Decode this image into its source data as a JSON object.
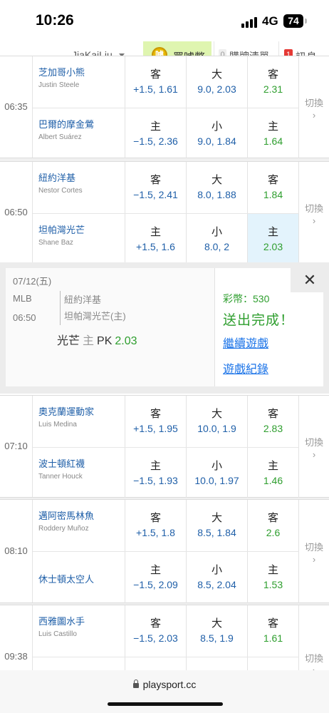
{
  "status_bar": {
    "time": "10:26",
    "network": "4G",
    "battery": "74"
  },
  "header": {
    "user": "JiaKaiLiu",
    "buy_label": "買噱幣",
    "buy_icon_text": "噱",
    "cart_count": "0",
    "cart_label": "購牌清單",
    "msg_count": "1",
    "msg_label": "訊息"
  },
  "switch_label": "切換",
  "switch_arrow": "›",
  "games": [
    {
      "time": "06:35",
      "away": {
        "team": "芝加哥小熊",
        "pitcher": "Justin Steele",
        "c1_top": "客",
        "c1_val": "+1.5, 1.61",
        "c2_top": "大",
        "c2_val": "9.0, 2.03",
        "c3_top": "客",
        "c3_val": "2.31"
      },
      "home": {
        "team": "巴爾的摩金鶯",
        "pitcher": "Albert Suárez",
        "c1_top": "主",
        "c1_val": "−1.5, 2.36",
        "c2_top": "小",
        "c2_val": "9.0, 1.84",
        "c3_top": "主",
        "c3_val": "1.64"
      }
    },
    {
      "time": "06:50",
      "away": {
        "team": "紐約洋基",
        "pitcher": "Nestor Cortes",
        "c1_top": "客",
        "c1_val": "−1.5, 2.41",
        "c2_top": "大",
        "c2_val": "8.0, 1.88",
        "c3_top": "客",
        "c3_val": "1.84"
      },
      "home": {
        "team": "坦帕灣光芒",
        "pitcher": "Shane Baz",
        "c1_top": "主",
        "c1_val": "+1.5, 1.6",
        "c2_top": "小",
        "c2_val": "8.0, 2",
        "c3_top": "主",
        "c3_val": "2.03"
      }
    },
    {
      "time": "07:10",
      "away": {
        "team": "奧克蘭運動家",
        "pitcher": "Luis Medina",
        "c1_top": "客",
        "c1_val": "+1.5, 1.95",
        "c2_top": "大",
        "c2_val": "10.0, 1.9",
        "c3_top": "客",
        "c3_val": "2.83"
      },
      "home": {
        "team": "波士頓紅襪",
        "pitcher": "Tanner Houck",
        "c1_top": "主",
        "c1_val": "−1.5, 1.93",
        "c2_top": "小",
        "c2_val": "10.0, 1.97",
        "c3_top": "主",
        "c3_val": "1.46"
      }
    },
    {
      "time": "08:10",
      "away": {
        "team": "邁阿密馬林魚",
        "pitcher": "Roddery Muñoz",
        "c1_top": "客",
        "c1_val": "+1.5, 1.8",
        "c2_top": "大",
        "c2_val": "8.5, 1.84",
        "c3_top": "客",
        "c3_val": "2.6"
      },
      "home": {
        "team": "休士頓太空人",
        "pitcher": "",
        "c1_top": "主",
        "c1_val": "−1.5, 2.09",
        "c2_top": "小",
        "c2_val": "8.5, 2.04",
        "c3_top": "主",
        "c3_val": "1.53"
      }
    },
    {
      "time": "09:38",
      "away": {
        "team": "西雅圖水手",
        "pitcher": "Luis Castillo",
        "c1_top": "客",
        "c1_val": "−1.5, 2.03",
        "c2_top": "大",
        "c2_val": "8.5, 1.9",
        "c3_top": "客",
        "c3_val": "1.61"
      }
    }
  ],
  "confirm_panel": {
    "date": "07/12(五)",
    "league": "MLB",
    "time": "06:50",
    "team1": "紐約洋基",
    "team2": "坦帕灣光芒(主)",
    "pick_team": "光芒",
    "pick_side": "主",
    "pick_type": "PK",
    "pick_odds": "2.03",
    "coins": "彩幣：530",
    "done": "送出完成！",
    "link_continue": "繼續遊戲",
    "link_records": "遊戲紀錄",
    "close": "✕"
  },
  "browser": {
    "url": "playsport.cc"
  }
}
